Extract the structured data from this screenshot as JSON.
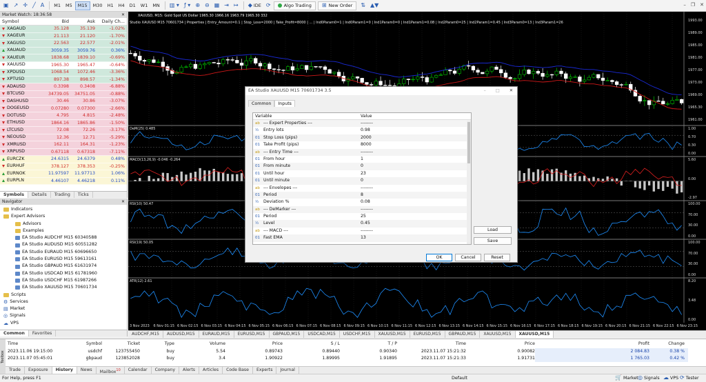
{
  "toolbar": {
    "timeframes": [
      "M1",
      "M5",
      "M15",
      "M30",
      "H1",
      "H4",
      "D1",
      "W1",
      "MN"
    ],
    "active_timeframe": "M15",
    "ide": "IDE",
    "algo": "Algo Trading",
    "new_order": "New Order"
  },
  "market_watch": {
    "title": "Market Watch: 18:36:58",
    "columns": [
      "Symbol",
      "Bid",
      "Ask",
      "Daily Ch..."
    ],
    "rows": [
      {
        "symbol": "XAGAUD",
        "bid": "35.128",
        "ask": "35.139",
        "change": "-1.02%",
        "dir": "dn",
        "bg": "#cfe8dc",
        "color": "#d02a2a"
      },
      {
        "symbol": "XAGEUR",
        "bid": "21.113",
        "ask": "21.120",
        "change": "-1.70%",
        "dir": "dn",
        "bg": "#cfe8dc",
        "color": "#d02a2a"
      },
      {
        "symbol": "XAGUSD",
        "bid": "22.563",
        "ask": "22.577",
        "change": "-2.01%",
        "dir": "dn",
        "bg": "#cfe8dc",
        "color": "#d02a2a"
      },
      {
        "symbol": "XAUAUD",
        "bid": "3059.35",
        "ask": "3059.76",
        "change": "0.36%",
        "dir": "up",
        "bg": "#cfe8dc",
        "color": "#1f49c7"
      },
      {
        "symbol": "XAUEUR",
        "bid": "1838.68",
        "ask": "1839.10",
        "change": "-0.69%",
        "dir": "dn",
        "bg": "#cfe8dc",
        "color": "#d02a2a"
      },
      {
        "symbol": "XAUUSD",
        "bid": "1965.30",
        "ask": "1965.47",
        "change": "-0.64%",
        "dir": "dn",
        "bg": "#ffffff",
        "color": "#d02a2a"
      },
      {
        "symbol": "XPDUSD",
        "bid": "1068.54",
        "ask": "1072.46",
        "change": "-3.36%",
        "dir": "dn",
        "bg": "#cfe8dc",
        "color": "#d02a2a"
      },
      {
        "symbol": "XPTUSD",
        "bid": "897.38",
        "ask": "898.57",
        "change": "-1.34%",
        "dir": "dn",
        "bg": "#cfe8dc",
        "color": "#d02a2a"
      },
      {
        "symbol": "ADAUSD",
        "bid": "0.3398",
        "ask": "0.3408",
        "change": "-6.88%",
        "dir": "dn",
        "bg": "#f4d2dc",
        "color": "#d02a2a"
      },
      {
        "symbol": "BTCUSD",
        "bid": "34739.05",
        "ask": "34751.05",
        "change": "-0.88%",
        "dir": "dn",
        "bg": "#f4d2dc",
        "color": "#d02a2a"
      },
      {
        "symbol": "DASHUSD",
        "bid": "30.46",
        "ask": "30.86",
        "change": "-3.07%",
        "dir": "dn",
        "bg": "#f4d2dc",
        "color": "#d02a2a"
      },
      {
        "symbol": "DOGEUSD",
        "bid": "0.07280",
        "ask": "0.07300",
        "change": "-2.66%",
        "dir": "dn",
        "bg": "#f4d2dc",
        "color": "#d02a2a"
      },
      {
        "symbol": "DOTUSD",
        "bid": "4.795",
        "ask": "4.815",
        "change": "-2.48%",
        "dir": "dn",
        "bg": "#f4d2dc",
        "color": "#d02a2a"
      },
      {
        "symbol": "ETHUSD",
        "bid": "1864.16",
        "ask": "1865.86",
        "change": "-1.50%",
        "dir": "dn",
        "bg": "#f4d2dc",
        "color": "#d02a2a"
      },
      {
        "symbol": "LTCUSD",
        "bid": "72.08",
        "ask": "72.26",
        "change": "-3.17%",
        "dir": "dn",
        "bg": "#f4d2dc",
        "color": "#d02a2a"
      },
      {
        "symbol": "NEOUSD",
        "bid": "12.36",
        "ask": "12.71",
        "change": "-5.29%",
        "dir": "dn",
        "bg": "#f4d2dc",
        "color": "#d02a2a"
      },
      {
        "symbol": "XMRUSD",
        "bid": "162.11",
        "ask": "164.31",
        "change": "-1.23%",
        "dir": "dn",
        "bg": "#f4d2dc",
        "color": "#d02a2a"
      },
      {
        "symbol": "XRPUSD",
        "bid": "0.67118",
        "ask": "0.67318",
        "change": "-7.11%",
        "dir": "dn",
        "bg": "#f4d2dc",
        "color": "#d02a2a"
      },
      {
        "symbol": "EURCZK",
        "bid": "24.6315",
        "ask": "24.6379",
        "change": "0.48%",
        "dir": "up",
        "bg": "#fbf6d6",
        "color": "#1f49c7"
      },
      {
        "symbol": "EURHUF",
        "bid": "378.127",
        "ask": "378.353",
        "change": "-0.25%",
        "dir": "dn",
        "bg": "#fbf6d6",
        "color": "#d02a2a"
      },
      {
        "symbol": "EURNOK",
        "bid": "11.97597",
        "ask": "11.97713",
        "change": "1.06%",
        "dir": "up",
        "bg": "#fbf6d6",
        "color": "#1f49c7"
      },
      {
        "symbol": "EURPLN",
        "bid": "4.46107",
        "ask": "4.46218",
        "change": "0.11%",
        "dir": "up",
        "bg": "#fbf6d6",
        "color": "#1f49c7"
      }
    ],
    "tabs": [
      "Symbols",
      "Details",
      "Trading",
      "Ticks"
    ]
  },
  "navigator": {
    "title": "Navigator",
    "items": [
      {
        "label": "Indicators",
        "level": 1,
        "icon": "folder"
      },
      {
        "label": "Expert Advisors",
        "level": 1,
        "icon": "folder"
      },
      {
        "label": "Advisors",
        "level": 2,
        "icon": "folder"
      },
      {
        "label": "Examples",
        "level": 2,
        "icon": "folder"
      },
      {
        "label": "EA Studio AUDCHF M15 60340588",
        "level": 2,
        "icon": "ea"
      },
      {
        "label": "EA Studio AUDUSD M15 60551282",
        "level": 2,
        "icon": "ea"
      },
      {
        "label": "EA Studio EURAUD M15 60696650",
        "level": 2,
        "icon": "ea"
      },
      {
        "label": "EA Studio EURUSD M15 59613161",
        "level": 2,
        "icon": "ea"
      },
      {
        "label": "EA Studio GBPAUD M15 61631974",
        "level": 2,
        "icon": "ea"
      },
      {
        "label": "EA Studio USDCAD M15 61781960",
        "level": 2,
        "icon": "ea"
      },
      {
        "label": "EA Studio USDCHF M15 61987266",
        "level": 2,
        "icon": "ea"
      },
      {
        "label": "EA Studio XAUUSD M15 70601734",
        "level": 2,
        "icon": "ea"
      },
      {
        "label": "Scripts",
        "level": 1,
        "icon": "folder"
      },
      {
        "label": "Services",
        "level": 1,
        "icon": "gear"
      },
      {
        "label": "Market",
        "level": 1,
        "icon": "cart"
      },
      {
        "label": "Signals",
        "level": 1,
        "icon": "signal"
      },
      {
        "label": "VPS",
        "level": 1,
        "icon": "vps"
      }
    ],
    "tabs": [
      "Common",
      "Favorites"
    ]
  },
  "chart": {
    "info1": "XAUUSD, M15:  Gold Spot US Dollar   1965.30 1966.16 1963.79 1965.30 332",
    "info2": "Studio XAUUSD M15 70601734 | Properties | Entry_Amount=0.1 | Stop_Loss=2000 | Take_Profit=8000 | ... | Ind0Param0=1 | Ind0Param1=0 | Ind1Param0=0 | Ind1Param1=0.08 | Ind2Param0=25 | Ind2Param1=0.45 | Ind3Param0=13 | Ind3Param1=26",
    "price_ticks": [
      "1993.00",
      "1989.00",
      "1985.00",
      "1981.00",
      "1977.00",
      "1973.00",
      "1969.00",
      "1965.30",
      "1961.00"
    ],
    "demarker_label": "DeM(25) 0.485",
    "demarker_ticks": [
      "1.00",
      "0.70",
      "0.30",
      "0.00"
    ],
    "macd_label": "MACD(13,26,9) -0.046 -0.264",
    "macd_ticks": [
      "5.60",
      "0.00",
      "-2.97"
    ],
    "rsi1_label": "RSI(10) 50.47",
    "rsi1_ticks": [
      "100.00",
      "70.00",
      "30.00",
      "0.00"
    ],
    "rsi2_label": "RSI(19) 50.05",
    "rsi2_ticks": [
      "100.00",
      "70.00",
      "30.00",
      "0.00"
    ],
    "atr_label": "ATR(12) 2.61",
    "atr_ticks": [
      "8.20",
      "3.48",
      "0.00"
    ],
    "time_labels": [
      "3 Nov 2023",
      "6 Nov 01:15",
      "6 Nov 02:15",
      "6 Nov 03:15",
      "6 Nov 04:15",
      "6 Nov 05:15",
      "6 Nov 06:15",
      "6 Nov 07:15",
      "6 Nov 08:15",
      "6 Nov 09:15",
      "6 Nov 10:15",
      "6 Nov 11:15",
      "6 Nov 12:15",
      "6 Nov 13:15",
      "6 Nov 14:15",
      "6 Nov 15:15",
      "6 Nov 16:15",
      "6 Nov 17:15",
      "6 Nov 18:15",
      "6 Nov 19:15",
      "6 Nov 20:15",
      "6 Nov 21:15",
      "6 Nov 22:15",
      "6 Nov 23:15"
    ],
    "tabs": [
      "AUDCHF,M15",
      "AUDUSD,M15",
      "EURAUD,M15",
      "EURUSD,M15",
      "GBPAUD,M15",
      "USDCAD,M15",
      "USDCHF,M15",
      "XAUUSD,M15",
      "EURUSD,M15",
      "GBPAUD,M15",
      "XAUUSD,M15",
      "XAUUSD,M15"
    ],
    "active_tab": 11,
    "colors": {
      "up": "#00c800",
      "down": "#ffffff",
      "env_upper": "#1a2ad8",
      "env_lower": "#d01818",
      "indicator": "#1e90ff",
      "grid": "#2a2a2a"
    }
  },
  "dialog": {
    "title": "EA Studio XAUUSD M15 70601734 3.5",
    "tabs": [
      "Common",
      "Inputs"
    ],
    "active_tab": "Inputs",
    "columns": [
      "Variable",
      "Value"
    ],
    "rows": [
      {
        "icon": "ab",
        "name": "--- Expert Properties ---",
        "value": "--------"
      },
      {
        "icon": "½",
        "name": "Entry lots",
        "value": "0.98"
      },
      {
        "icon": "01",
        "name": "Stop Loss    (pips)",
        "value": "2000"
      },
      {
        "icon": "01",
        "name": "Take Profit (pips)",
        "value": "8000"
      },
      {
        "icon": "ab",
        "name": "--- Entry Time ---",
        "value": "--------"
      },
      {
        "icon": "01",
        "name": "From hour",
        "value": "1"
      },
      {
        "icon": "01",
        "name": "From minute",
        "value": "0"
      },
      {
        "icon": "01",
        "name": "Until hour",
        "value": "23"
      },
      {
        "icon": "01",
        "name": "Until minute",
        "value": "0"
      },
      {
        "icon": "ab",
        "name": "--- Envelopes ---",
        "value": "--------"
      },
      {
        "icon": "01",
        "name": "Period",
        "value": "8"
      },
      {
        "icon": "½",
        "name": "Deviation %",
        "value": "0.08"
      },
      {
        "icon": "ab",
        "name": "--- DeMarker ---",
        "value": "--------"
      },
      {
        "icon": "01",
        "name": "Period",
        "value": "25"
      },
      {
        "icon": "½",
        "name": "Level",
        "value": "0.45"
      },
      {
        "icon": "ab",
        "name": "--- MACD ---",
        "value": "--------"
      },
      {
        "icon": "01",
        "name": "Fast EMA",
        "value": "13"
      }
    ],
    "load": "Load",
    "save": "Save",
    "ok": "OK",
    "cancel": "Cancel",
    "reset": "Reset"
  },
  "history": {
    "columns": [
      "Time",
      "Symbol",
      "Ticket",
      "Type",
      "Volume",
      "Price",
      "S / L",
      "T / P",
      "Time",
      "Price",
      "Profit",
      "Change"
    ],
    "rows": [
      [
        "2023.11.06 19:15:00",
        "usdchf",
        "123755450",
        "buy",
        "5.54",
        "0.89743",
        "0.89440",
        "0.90340",
        "2023.11.07 15:21:32",
        "0.90082",
        "2 084.83",
        "0.38 %"
      ],
      [
        "2023.11.07 05:45:01",
        "gbpaud",
        "123852028",
        "buy",
        "3.4",
        "1.90922",
        "1.89995",
        "1.91895",
        "2023.11.07 15:21:33",
        "1.91731",
        "1 765.03",
        "0.42 %"
      ]
    ],
    "side_label": "Toolbox"
  },
  "bottom_tabs": [
    {
      "label": "Trade"
    },
    {
      "label": "Exposure"
    },
    {
      "label": "History",
      "active": true
    },
    {
      "label": "News"
    },
    {
      "label": "Mailbox",
      "badge": "10"
    },
    {
      "label": "Calendar"
    },
    {
      "label": "Company"
    },
    {
      "label": "Alerts"
    },
    {
      "label": "Articles"
    },
    {
      "label": "Code Base"
    },
    {
      "label": "Experts"
    },
    {
      "label": "Journal"
    }
  ],
  "status": {
    "help": "For Help, press F1",
    "profile": "Default",
    "market": "Market",
    "signals": "Signals",
    "vps": "VPS",
    "tester": "Tester",
    "memory": "498 / 107 Mb"
  }
}
